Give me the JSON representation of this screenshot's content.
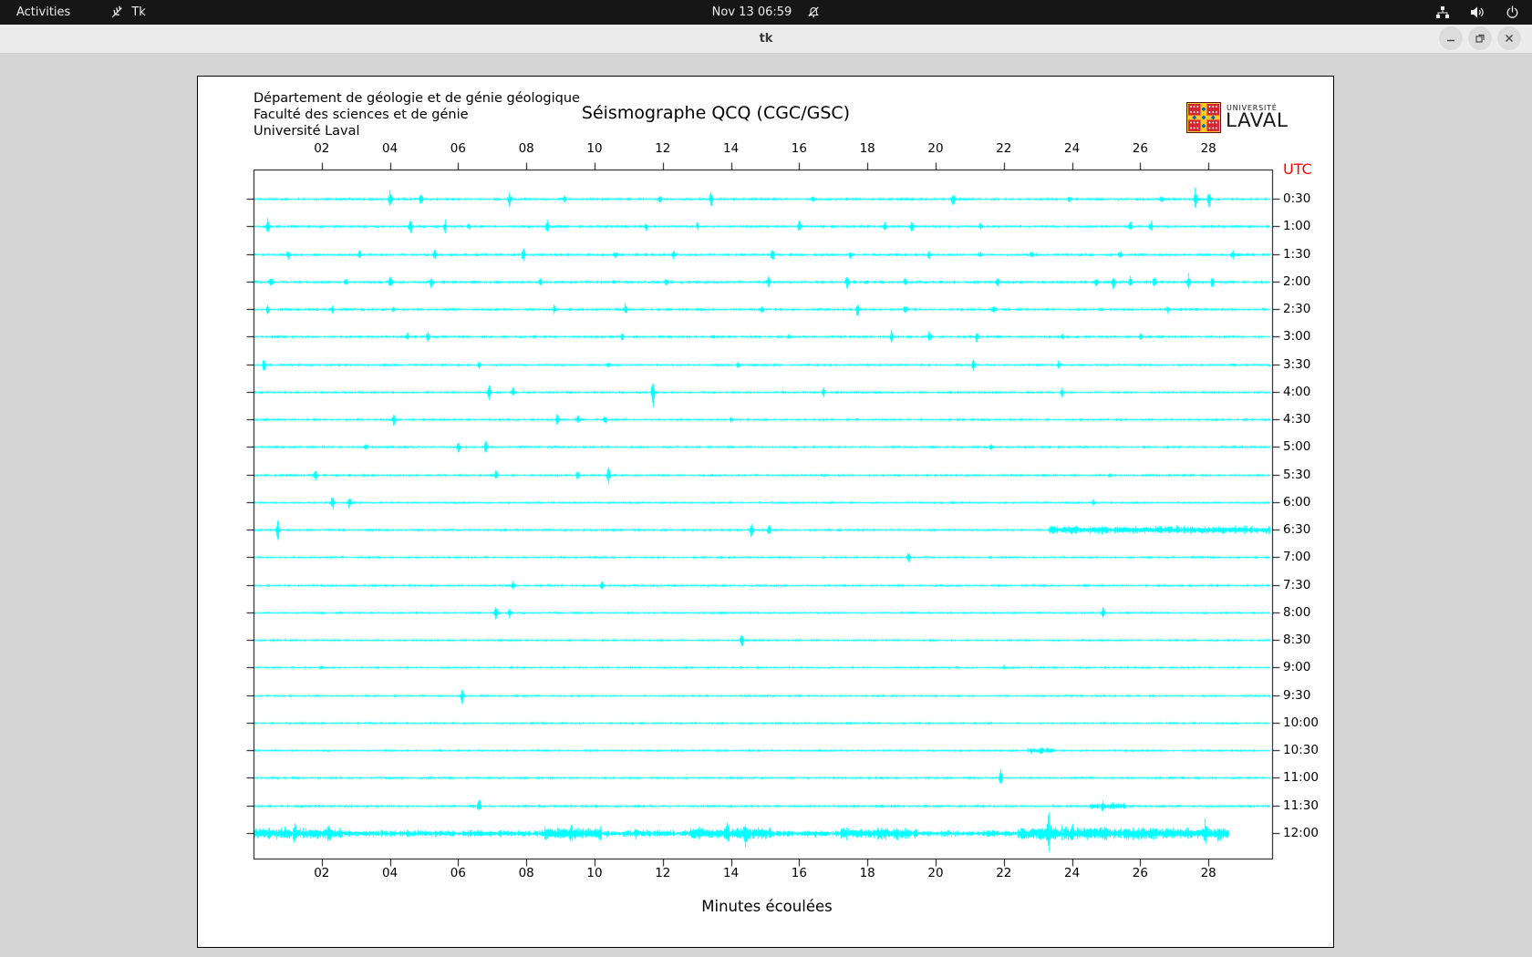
{
  "top_bar": {
    "activities_label": "Activities",
    "app_menu_label": "Tk",
    "clock": "Nov 13  06:59",
    "icon_names": [
      "tk-feather-icon",
      "notifications-disabled-icon",
      "network-wired-icon",
      "volume-icon",
      "power-icon"
    ]
  },
  "window": {
    "title": "tk",
    "controls": {
      "minimize": "minimize",
      "maximize": "maximize",
      "close": "close"
    }
  },
  "seismograph": {
    "org_lines": [
      "Département de géologie et de génie géologique",
      "Faculté des sciences et de génie",
      "Université Laval"
    ],
    "title": "Séismographe QCQ (CGC/GSC)",
    "logo": {
      "line1": "UNIVERSITÉ",
      "line2": "LAVAL"
    },
    "utc_label": "UTC",
    "xlabel": "Minutes écoulées",
    "colors": {
      "trace": "#00ffff",
      "axis": "#000000",
      "utc": "#ff0000"
    },
    "chart_data": {
      "type": "seismograph",
      "x_minutes_range": [
        0,
        30
      ],
      "x_ticks": [
        "02",
        "04",
        "06",
        "08",
        "10",
        "12",
        "14",
        "16",
        "18",
        "20",
        "22",
        "24",
        "26",
        "28"
      ],
      "traces": [
        {
          "label": "0:30",
          "noise": 1.3,
          "end": 29.8,
          "events": [
            [
              4.0,
              9
            ],
            [
              4.9,
              6
            ],
            [
              7.5,
              10
            ],
            [
              9.1,
              4
            ],
            [
              11.9,
              5
            ],
            [
              13.4,
              8
            ],
            [
              16.4,
              4
            ],
            [
              20.5,
              10
            ],
            [
              23.9,
              4
            ],
            [
              26.6,
              4
            ],
            [
              27.6,
              13
            ],
            [
              28.0,
              11
            ]
          ],
          "bursts": []
        },
        {
          "label": "1:00",
          "noise": 1.3,
          "end": 29.8,
          "events": [
            [
              0.4,
              9
            ],
            [
              4.6,
              11
            ],
            [
              5.6,
              7
            ],
            [
              6.3,
              5
            ],
            [
              8.6,
              10
            ],
            [
              11.5,
              4
            ],
            [
              13.0,
              4
            ],
            [
              16.0,
              8
            ],
            [
              18.5,
              6
            ],
            [
              19.3,
              7
            ],
            [
              21.3,
              5
            ],
            [
              25.7,
              6
            ],
            [
              26.3,
              5
            ]
          ],
          "bursts": []
        },
        {
          "label": "1:30",
          "noise": 1.3,
          "end": 29.8,
          "events": [
            [
              1.0,
              5
            ],
            [
              3.1,
              4
            ],
            [
              5.3,
              8
            ],
            [
              7.9,
              7
            ],
            [
              10.6,
              4
            ],
            [
              12.3,
              6
            ],
            [
              15.2,
              7
            ],
            [
              17.5,
              5
            ],
            [
              19.8,
              5
            ],
            [
              21.3,
              4
            ],
            [
              22.8,
              5
            ],
            [
              25.4,
              4
            ],
            [
              28.7,
              5
            ]
          ],
          "bursts": []
        },
        {
          "label": "2:00",
          "noise": 1.4,
          "end": 29.8,
          "events": [
            [
              0.5,
              6
            ],
            [
              2.7,
              5
            ],
            [
              4.0,
              8
            ],
            [
              5.2,
              6
            ],
            [
              8.4,
              5
            ],
            [
              12.1,
              5
            ],
            [
              15.1,
              6
            ],
            [
              17.4,
              8
            ],
            [
              19.1,
              5
            ],
            [
              21.8,
              6
            ],
            [
              24.7,
              5
            ],
            [
              25.2,
              9
            ],
            [
              25.7,
              8
            ],
            [
              26.4,
              7
            ],
            [
              27.4,
              10
            ],
            [
              28.1,
              6
            ]
          ],
          "bursts": []
        },
        {
          "label": "2:30",
          "noise": 1.3,
          "end": 29.8,
          "events": [
            [
              0.4,
              7
            ],
            [
              2.3,
              5
            ],
            [
              4.1,
              4
            ],
            [
              8.8,
              5
            ],
            [
              10.9,
              7
            ],
            [
              14.9,
              4
            ],
            [
              17.7,
              9
            ],
            [
              19.1,
              6
            ],
            [
              21.7,
              6
            ],
            [
              26.8,
              4
            ]
          ],
          "bursts": []
        },
        {
          "label": "3:00",
          "noise": 1.3,
          "end": 29.8,
          "events": [
            [
              4.5,
              5
            ],
            [
              5.1,
              7
            ],
            [
              10.8,
              4
            ],
            [
              15.7,
              4
            ],
            [
              18.7,
              8
            ],
            [
              19.8,
              6
            ],
            [
              21.2,
              5
            ],
            [
              23.7,
              4
            ],
            [
              26.0,
              3
            ]
          ],
          "bursts": []
        },
        {
          "label": "3:30",
          "noise": 1.2,
          "end": 29.8,
          "events": [
            [
              0.3,
              8
            ],
            [
              6.6,
              4
            ],
            [
              10.4,
              5
            ],
            [
              14.2,
              4
            ],
            [
              21.1,
              7
            ],
            [
              23.6,
              4
            ]
          ],
          "bursts": []
        },
        {
          "label": "4:00",
          "noise": 1.2,
          "end": 29.8,
          "events": [
            [
              6.9,
              8
            ],
            [
              7.6,
              6
            ],
            [
              11.7,
              16
            ],
            [
              16.7,
              7
            ],
            [
              23.7,
              4
            ]
          ],
          "bursts": []
        },
        {
          "label": "4:30",
          "noise": 1.2,
          "end": 29.8,
          "events": [
            [
              4.1,
              6
            ],
            [
              8.9,
              8
            ],
            [
              9.5,
              7
            ],
            [
              10.3,
              6
            ],
            [
              14.0,
              3
            ]
          ],
          "bursts": []
        },
        {
          "label": "5:00",
          "noise": 1.2,
          "end": 29.8,
          "events": [
            [
              3.3,
              4
            ],
            [
              6.0,
              7
            ],
            [
              6.8,
              8
            ],
            [
              21.6,
              3
            ]
          ],
          "bursts": []
        },
        {
          "label": "5:30",
          "noise": 1.2,
          "end": 29.8,
          "events": [
            [
              1.8,
              7
            ],
            [
              7.1,
              8
            ],
            [
              9.5,
              5
            ],
            [
              10.4,
              12
            ],
            [
              25.1,
              3
            ]
          ],
          "bursts": []
        },
        {
          "label": "6:00",
          "noise": 1.1,
          "end": 29.8,
          "events": [
            [
              2.3,
              9
            ],
            [
              2.8,
              7
            ],
            [
              24.6,
              3
            ]
          ],
          "bursts": []
        },
        {
          "label": "6:30",
          "noise": 1.2,
          "end": 29.8,
          "events": [
            [
              0.7,
              12
            ],
            [
              14.6,
              10
            ],
            [
              15.1,
              7
            ]
          ],
          "bursts": [
            [
              23.3,
              29.8,
              3
            ]
          ]
        },
        {
          "label": "7:00",
          "noise": 1.1,
          "end": 29.8,
          "events": [
            [
              19.2,
              10
            ]
          ],
          "bursts": []
        },
        {
          "label": "7:30",
          "noise": 1.2,
          "end": 29.8,
          "events": [
            [
              7.6,
              4
            ],
            [
              10.2,
              5
            ]
          ],
          "bursts": []
        },
        {
          "label": "8:00",
          "noise": 1.1,
          "end": 29.8,
          "events": [
            [
              7.1,
              9
            ],
            [
              7.5,
              7
            ],
            [
              24.9,
              8
            ]
          ],
          "bursts": []
        },
        {
          "label": "8:30",
          "noise": 1.1,
          "end": 29.8,
          "events": [
            [
              14.3,
              11
            ]
          ],
          "bursts": []
        },
        {
          "label": "9:00",
          "noise": 1.1,
          "end": 29.8,
          "events": [
            [
              2.0,
              2
            ],
            [
              22.0,
              2
            ]
          ],
          "bursts": []
        },
        {
          "label": "9:30",
          "noise": 1.1,
          "end": 29.8,
          "events": [
            [
              6.1,
              9
            ]
          ],
          "bursts": []
        },
        {
          "label": "10:00",
          "noise": 1.1,
          "end": 29.8,
          "events": [],
          "bursts": []
        },
        {
          "label": "10:30",
          "noise": 1.1,
          "end": 29.8,
          "events": [
            [
              23.1,
              4
            ]
          ],
          "bursts": [
            [
              22.7,
              23.5,
              2
            ]
          ]
        },
        {
          "label": "11:00",
          "noise": 1.2,
          "end": 29.8,
          "events": [
            [
              21.9,
              10
            ]
          ],
          "bursts": []
        },
        {
          "label": "11:30",
          "noise": 1.3,
          "end": 29.8,
          "events": [
            [
              6.6,
              9
            ],
            [
              24.9,
              4
            ],
            [
              25.2,
              3
            ]
          ],
          "bursts": [
            [
              24.5,
              25.6,
              2
            ]
          ]
        },
        {
          "label": "12:00",
          "noise": 3.0,
          "end": 28.6,
          "events": [
            [
              1.2,
              8
            ],
            [
              2.2,
              6
            ],
            [
              9.3,
              7
            ],
            [
              11.2,
              5
            ],
            [
              13.9,
              8
            ],
            [
              14.4,
              10
            ],
            [
              19.4,
              5
            ],
            [
              23.3,
              20
            ],
            [
              24.0,
              6
            ],
            [
              27.9,
              14
            ],
            [
              28.3,
              8
            ]
          ],
          "bursts": [
            [
              0,
              2.6,
              3
            ],
            [
              8.4,
              10.2,
              3
            ],
            [
              12.8,
              15.2,
              3.5
            ],
            [
              17.2,
              19.2,
              3
            ],
            [
              22.4,
              26.6,
              4
            ],
            [
              26.6,
              28.6,
              3
            ]
          ]
        }
      ]
    }
  }
}
